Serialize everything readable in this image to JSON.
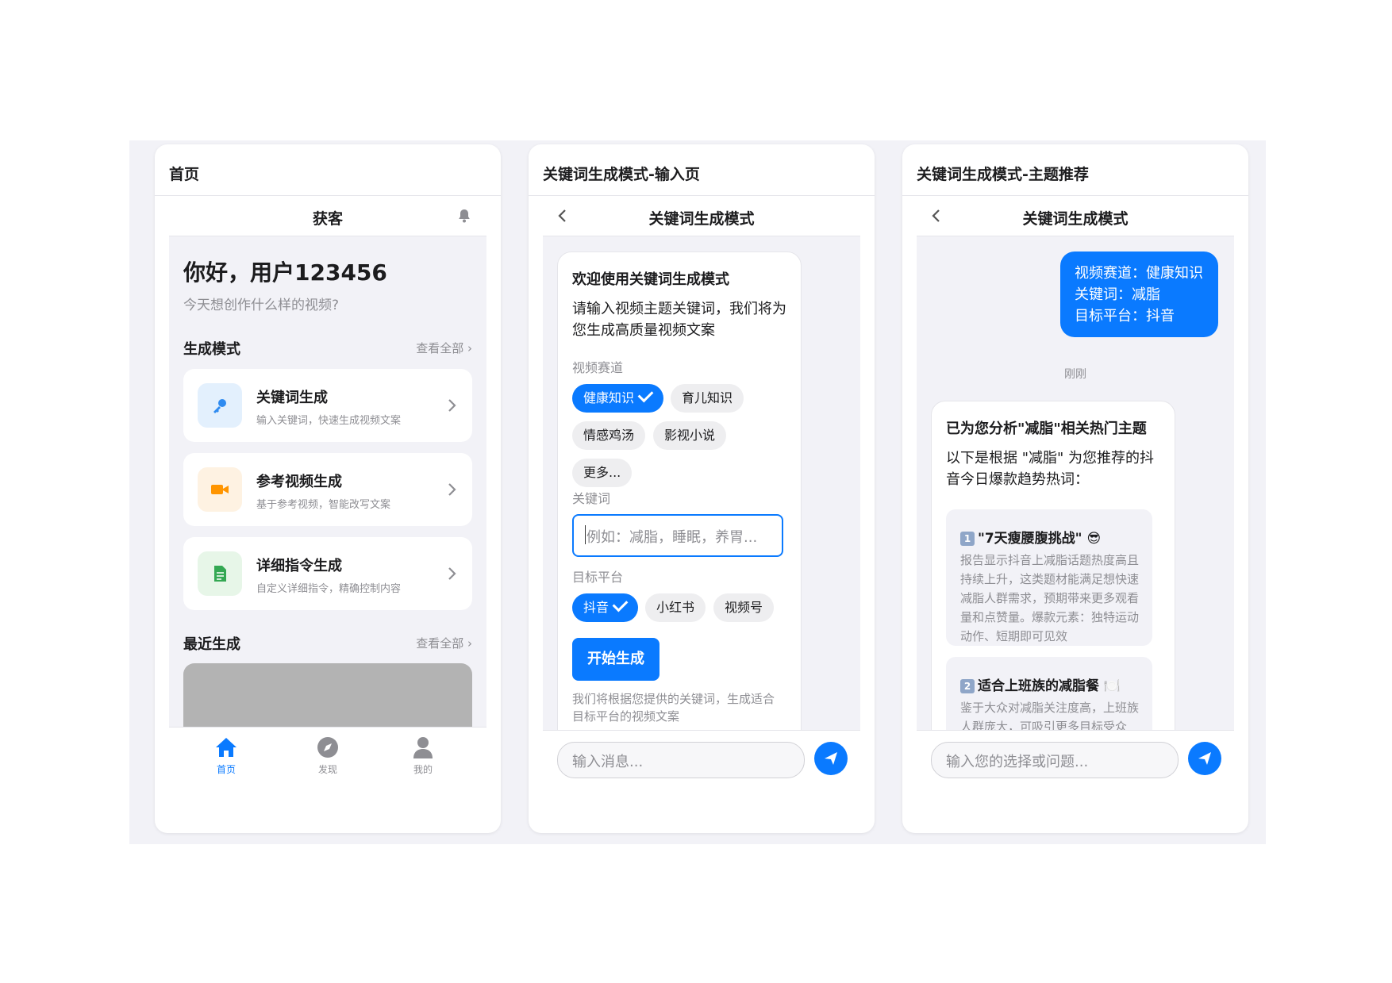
{
  "colors": {
    "accent": "#0a7aff",
    "bg": "#f2f2f7"
  },
  "card1": {
    "header": "首页",
    "nav_title": "获客",
    "greeting": "你好，用户123456",
    "subtitle": "今天想创作什么样的视频?",
    "section_modes": "生成模式",
    "view_all": "查看全部",
    "modes": [
      {
        "title": "关键词生成",
        "desc": "输入关键词，快速生成视频文案",
        "icon": "key-icon",
        "color": "#e3f0fd"
      },
      {
        "title": "参考视频生成",
        "desc": "基于参考视频，智能改写文案",
        "icon": "video-camera-icon",
        "color": "#fef2e2"
      },
      {
        "title": "详细指令生成",
        "desc": "自定义详细指令，精确控制内容",
        "icon": "document-icon",
        "color": "#e7f6e8"
      }
    ],
    "section_recent": "最近生成",
    "tabs": [
      {
        "label": "首页",
        "icon": "home-icon",
        "active": true
      },
      {
        "label": "发现",
        "icon": "compass-icon"
      },
      {
        "label": "我的",
        "icon": "user-icon"
      }
    ]
  },
  "card2": {
    "header": "关键词生成模式-输入页",
    "nav_title": "关键词生成模式",
    "bubble_title": "欢迎使用关键词生成模式",
    "bubble_text": "请输入视频主题关键词，我们将为您生成高质量视频文案",
    "label_track": "视频赛道",
    "tracks": [
      "健康知识",
      "育儿知识",
      "情感鸡汤",
      "影视小说",
      "更多..."
    ],
    "label_keyword": "关键词",
    "keyword_placeholder": "例如：减脂，睡眠，养胃...",
    "label_platform": "目标平台",
    "platforms": [
      "抖音",
      "小红书",
      "视频号"
    ],
    "start_button": "开始生成",
    "footer_text": "我们将根据您提供的关键词，生成适合目标平台的视频文案",
    "composer_placeholder": "输入消息..."
  },
  "card3": {
    "header": "关键词生成模式-主题推荐",
    "nav_title": "关键词生成模式",
    "user_lines": [
      "视频赛道：健康知识",
      "关键词：减脂",
      "目标平台：抖音"
    ],
    "timestamp": "刚刚",
    "reply_title": "已为您分析\"减脂\"相关热门主题",
    "reply_text": "以下是根据 \"减脂\" 为您推荐的抖音今日爆款趋势热词：",
    "topics": [
      {
        "num": "1",
        "title": "\"7天瘦腰腹挑战\" 😎",
        "desc": "报告显示抖音上减脂话题热度高且持续上升，这类题材能满足想快速减脂人群需求，预期带来更多观看量和点赞量。爆款元素：独特运动动作、短期即可见效"
      },
      {
        "num": "2",
        "title": "适合上班族的减脂餐 🍽️",
        "desc": "鉴于大众对减脂关注度高，上班族人群庞大，可吸引更多目标受众"
      }
    ],
    "composer_placeholder": "输入您的选择或问题..."
  }
}
